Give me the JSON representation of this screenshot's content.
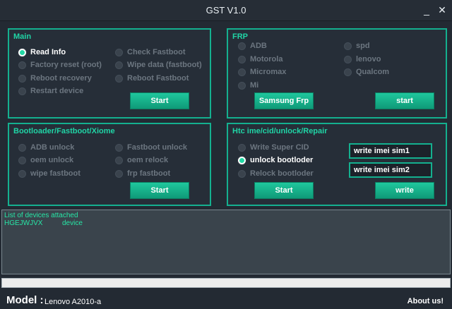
{
  "window": {
    "title": "GST V1.0",
    "minimize": "_",
    "close": "✕"
  },
  "main": {
    "title": "Main",
    "options": [
      "Read Info",
      "Factory reset (root)",
      "Reboot recovery",
      "Restart device",
      "Check Fastboot",
      "Wipe data (fastboot)",
      "Reboot Fastboot"
    ],
    "selected": "Read Info",
    "start": "Start"
  },
  "frp": {
    "title": "FRP",
    "options": [
      "ADB",
      "Motorola",
      "Micromax",
      "Mi",
      "spd",
      "lenovo",
      "Qualcom"
    ],
    "samsung_button": "Samsung Frp",
    "start": "start"
  },
  "bootloader": {
    "title": "Bootloader/Fastboot/Xiome",
    "options": [
      "ADB unlock",
      "oem unlock",
      "wipe fastboot",
      "Fastboot unlock",
      "oem relock",
      "frp fastboot"
    ],
    "start": "Start"
  },
  "htc": {
    "title": "Htc ime/cid/unlock/Repair",
    "options": [
      "Write Super CID",
      "unlock bootloder",
      "Relock bootloder"
    ],
    "selected": "unlock bootloder",
    "imei1": "write imei sim1",
    "imei2": "write imei sim2",
    "start": "Start",
    "write": "write"
  },
  "log": {
    "header": "List of devices attached",
    "serial": "HGEJWJVX",
    "state": "device"
  },
  "progress": {
    "value": 0
  },
  "footer": {
    "model_label": "Model :",
    "model_value": "Lenovo A2010-a",
    "about": "About us!"
  },
  "colors": {
    "accent": "#14b08f",
    "accent_text": "#20d5a6",
    "log_text": "#27e6a6",
    "background": "#232a33"
  }
}
